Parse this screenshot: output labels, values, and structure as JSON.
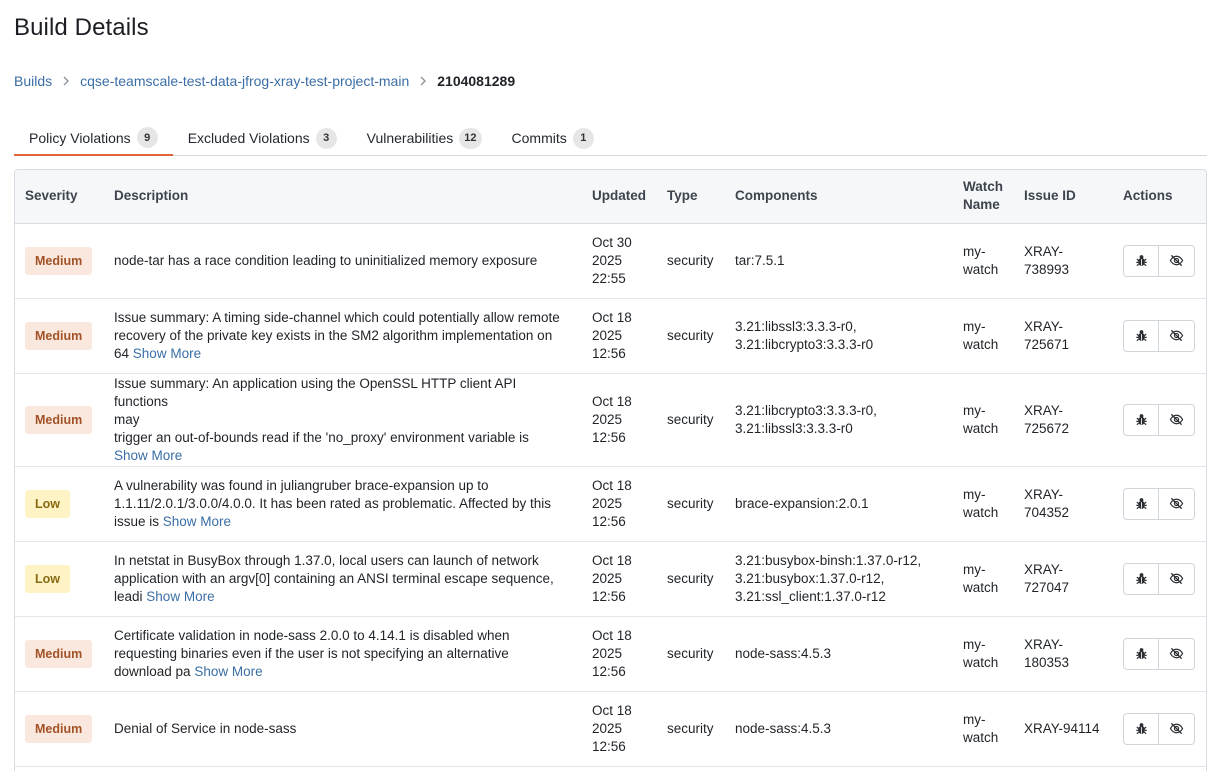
{
  "page": {
    "title": "Build Details"
  },
  "breadcrumb": {
    "items": [
      "Builds",
      "cqse-teamscale-test-data-jfrog-xray-test-project-main"
    ],
    "current": "2104081289"
  },
  "tabs": [
    {
      "label": "Policy Violations",
      "count": "9",
      "active": true
    },
    {
      "label": "Excluded Violations",
      "count": "3",
      "active": false
    },
    {
      "label": "Vulnerabilities",
      "count": "12",
      "active": false
    },
    {
      "label": "Commits",
      "count": "1",
      "active": false
    }
  ],
  "table": {
    "columns": {
      "severity": "Severity",
      "description": "Description",
      "updated": "Updated",
      "type": "Type",
      "components": "Components",
      "watch_name_1": "Watch",
      "watch_name_2": "Name",
      "issue_id": "Issue ID",
      "actions": "Actions"
    },
    "show_more_label": "Show More",
    "rows": [
      {
        "severity": "Medium",
        "desc_lines": [
          "node-tar has a race condition leading to uninitialized memory exposure"
        ],
        "show_more": false,
        "updated": [
          "Oct 30",
          "2025",
          "22:55"
        ],
        "type": "security",
        "components": [
          "tar:7.5.1"
        ],
        "watch": [
          "my-",
          "watch"
        ],
        "issue_id": "XRAY-738993"
      },
      {
        "severity": "Medium",
        "desc_lines": [
          "Issue summary: A timing side-channel which could potentially allow remote",
          "recovery of the private key exists in the SM2 algorithm implementation on",
          "64"
        ],
        "show_more": true,
        "updated": [
          "Oct 18",
          "2025",
          "12:56"
        ],
        "type": "security",
        "components": [
          "3.21:libssl3:3.3.3-r0,",
          "3.21:libcrypto3:3.3.3-r0"
        ],
        "watch": [
          "my-",
          "watch"
        ],
        "issue_id": "XRAY-725671"
      },
      {
        "severity": "Medium",
        "desc_lines": [
          "Issue summary: An application using the OpenSSL HTTP client API functions",
          "may",
          "trigger an out-of-bounds read if the 'no_proxy' environment variable is",
          ""
        ],
        "show_more": true,
        "updated": [
          "Oct 18",
          "2025",
          "12:56"
        ],
        "type": "security",
        "components": [
          "3.21:libcrypto3:3.3.3-r0,",
          "3.21:libssl3:3.3.3-r0"
        ],
        "watch": [
          "my-",
          "watch"
        ],
        "issue_id": "XRAY-725672"
      },
      {
        "severity": "Low",
        "desc_lines": [
          "A vulnerability was found in juliangruber brace-expansion up to",
          "1.1.11/2.0.1/3.0.0/4.0.0. It has been rated as problematic. Affected by this",
          "issue is"
        ],
        "show_more": true,
        "updated": [
          "Oct 18",
          "2025",
          "12:56"
        ],
        "type": "security",
        "components": [
          "brace-expansion:2.0.1"
        ],
        "watch": [
          "my-",
          "watch"
        ],
        "issue_id": "XRAY-704352"
      },
      {
        "severity": "Low",
        "desc_lines": [
          "In netstat in BusyBox through 1.37.0, local users can launch of network",
          "application with an argv[0] containing an ANSI terminal escape sequence,",
          "leadi"
        ],
        "show_more": true,
        "updated": [
          "Oct 18",
          "2025",
          "12:56"
        ],
        "type": "security",
        "components": [
          "3.21:busybox-binsh:1.37.0-r12,",
          "3.21:busybox:1.37.0-r12,",
          "3.21:ssl_client:1.37.0-r12"
        ],
        "watch": [
          "my-",
          "watch"
        ],
        "issue_id": "XRAY-727047"
      },
      {
        "severity": "Medium",
        "desc_lines": [
          "Certificate validation in node-sass 2.0.0 to 4.14.1 is disabled when",
          "requesting binaries even if the user is not specifying an alternative",
          "download pa"
        ],
        "show_more": true,
        "updated": [
          "Oct 18",
          "2025",
          "12:56"
        ],
        "type": "security",
        "components": [
          "node-sass:4.5.3"
        ],
        "watch": [
          "my-",
          "watch"
        ],
        "issue_id": "XRAY-180353"
      },
      {
        "severity": "Medium",
        "desc_lines": [
          "Denial of Service in node-sass"
        ],
        "show_more": false,
        "updated": [
          "Oct 18",
          "2025",
          "12:56"
        ],
        "type": "security",
        "components": [
          "node-sass:4.5.3"
        ],
        "watch": [
          "my-",
          "watch"
        ],
        "issue_id": "XRAY-94114"
      }
    ]
  },
  "icons": {
    "create_issue": "bug-icon",
    "ignore": "eye-off-icon"
  },
  "colors": {
    "accent": "#e2653a",
    "link": "#3a6ea5",
    "medium_bg": "#fae8de",
    "medium_fg": "#a25227",
    "low_bg": "#fdf3c4",
    "low_fg": "#8a6a12"
  }
}
